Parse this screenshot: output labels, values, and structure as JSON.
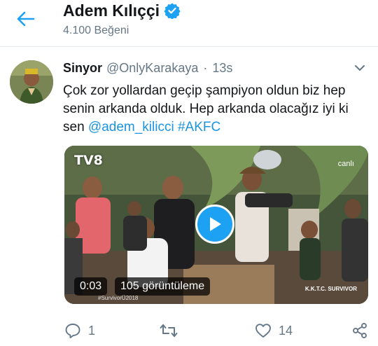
{
  "header": {
    "title": "Adem Kılıççi",
    "subtitle": "4.100 Beğeni",
    "back_icon": "arrow-left-icon",
    "verified_icon": "verified-badge-icon"
  },
  "tweet": {
    "author_name": "Sinyor",
    "author_handle": "@OnlyKarakaya",
    "separator": "·",
    "time": "13s",
    "text_plain": "Çok zor yollardan geçip şampiyon oldun biz hep senin arkanda olduk. Hep arkanda olacağız iyi ki sen",
    "mention": "@adem_kilicci",
    "hashtag": "#AKFC",
    "menu_icon": "chevron-down-icon"
  },
  "media": {
    "channel_logo": "TV8",
    "live_tag": "canlı",
    "duration": "0:03",
    "views": "105 görüntüleme",
    "overlay_hashtag": "#SurvivorÜ2018",
    "overlay_brand": "K.K.T.C. SURVIVOR",
    "play_icon": "play-icon"
  },
  "actions": {
    "reply_count": "1",
    "retweet_count": "",
    "like_count": "14",
    "reply_icon": "reply-icon",
    "retweet_icon": "retweet-icon",
    "like_icon": "heart-icon",
    "share_icon": "share-icon"
  },
  "colors": {
    "accent": "#1da1f2",
    "link": "#1b95e0",
    "muted": "#657786"
  }
}
